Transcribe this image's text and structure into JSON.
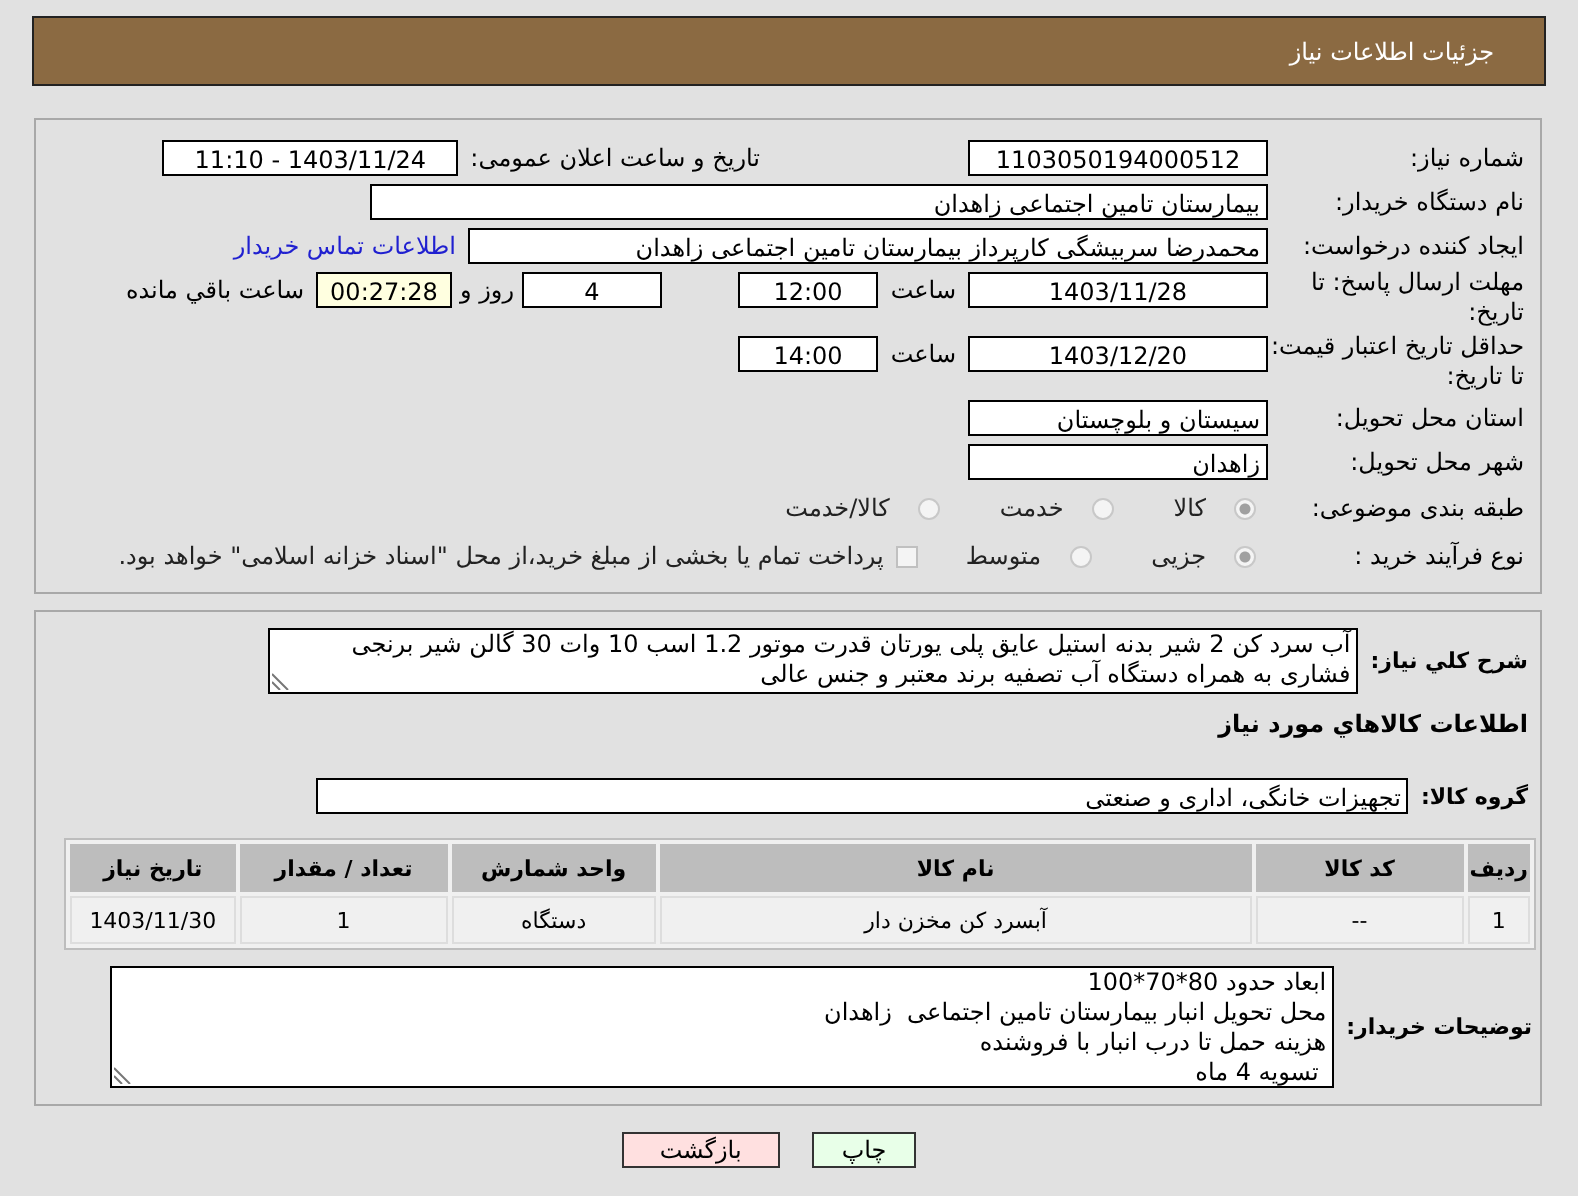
{
  "header": {
    "title": "جزئیات اطلاعات نیاز"
  },
  "need_number": {
    "label": "شماره نیاز:",
    "value": "1103050194000512"
  },
  "announce": {
    "label": "تاریخ و ساعت اعلان عمومی:",
    "value": "1403/11/24 - 11:10"
  },
  "buyer": {
    "label": "نام دستگاه خریدار:",
    "value": "بیمارستان تامین اجتماعی زاهدان"
  },
  "requester": {
    "label": "ایجاد کننده درخواست:",
    "value": "محمدرضا سربیشگی کارپرداز بیمارستان تامین اجتماعی زاهدان",
    "link": "اطلاعات تماس خریدار"
  },
  "deadline": {
    "label": "مهلت ارسال پاسخ: تا تاریخ:",
    "date": "1403/11/28",
    "time_label": "ساعت",
    "time": "12:00",
    "days": "4",
    "days_label": "روز و",
    "remaining": "00:27:28",
    "remaining_label": "ساعت باقي مانده"
  },
  "validity": {
    "label": "حداقل تاریخ اعتبار قیمت: تا تاریخ:",
    "date": "1403/12/20",
    "time_label": "ساعت",
    "time": "14:00"
  },
  "province": {
    "label": "استان محل تحویل:",
    "value": "سیستان و بلوچستان"
  },
  "city": {
    "label": "شهر محل تحویل:",
    "value": "زاهدان"
  },
  "category": {
    "label": "طبقه بندی موضوعی:",
    "options": [
      {
        "label": "کالا",
        "selected": true
      },
      {
        "label": "خدمت",
        "selected": false
      },
      {
        "label": "کالا/خدمت",
        "selected": false
      }
    ]
  },
  "process": {
    "label": "نوع فرآیند خرید :",
    "options": [
      {
        "label": "جزیی",
        "selected": true
      },
      {
        "label": "متوسط",
        "selected": false
      }
    ],
    "checkbox": {
      "label": "پرداخت تمام یا بخشی از مبلغ خرید،از محل \"اسناد خزانه اسلامی\" خواهد بود.",
      "checked": false
    }
  },
  "description": {
    "label": "شرح کلي نیاز:",
    "value": "آب سرد کن 2 شیر  بدنه استیل  عایق پلی یورتان  قدرت موتور 1.2  اسب 10 وات 30 گالن شیر برنجی فشاری به همراه دستگاه  آب تصفیه برند معتبر و جنس عالی"
  },
  "goods_heading": "اطلاعات کالاهاي مورد نياز",
  "goods_group": {
    "label": "گروه کالا:",
    "value": "تجهیزات خانگی، اداری و صنعتی"
  },
  "table": {
    "columns": [
      "ردیف",
      "کد کالا",
      "نام کالا",
      "واحد شمارش",
      "تعداد / مقدار",
      "تاریخ نیاز"
    ],
    "rows": [
      [
        "1",
        "--",
        "آبسرد کن مخزن دار",
        "دستگاه",
        "1",
        "1403/11/30"
      ]
    ]
  },
  "buyer_notes": {
    "label": "توضیحات خریدار:",
    "lines": [
      "ابعاد حدود 80*70*100",
      "محل تحویل انبار بیمارستان تامین اجتماعی  زاهدان",
      "هزینه حمل تا درب انبار با فروشنده",
      " تسویه 4 ماه"
    ]
  },
  "buttons": [
    {
      "label": "چاپ",
      "kind": "print"
    },
    {
      "label": "بازگشت",
      "kind": "back"
    }
  ]
}
